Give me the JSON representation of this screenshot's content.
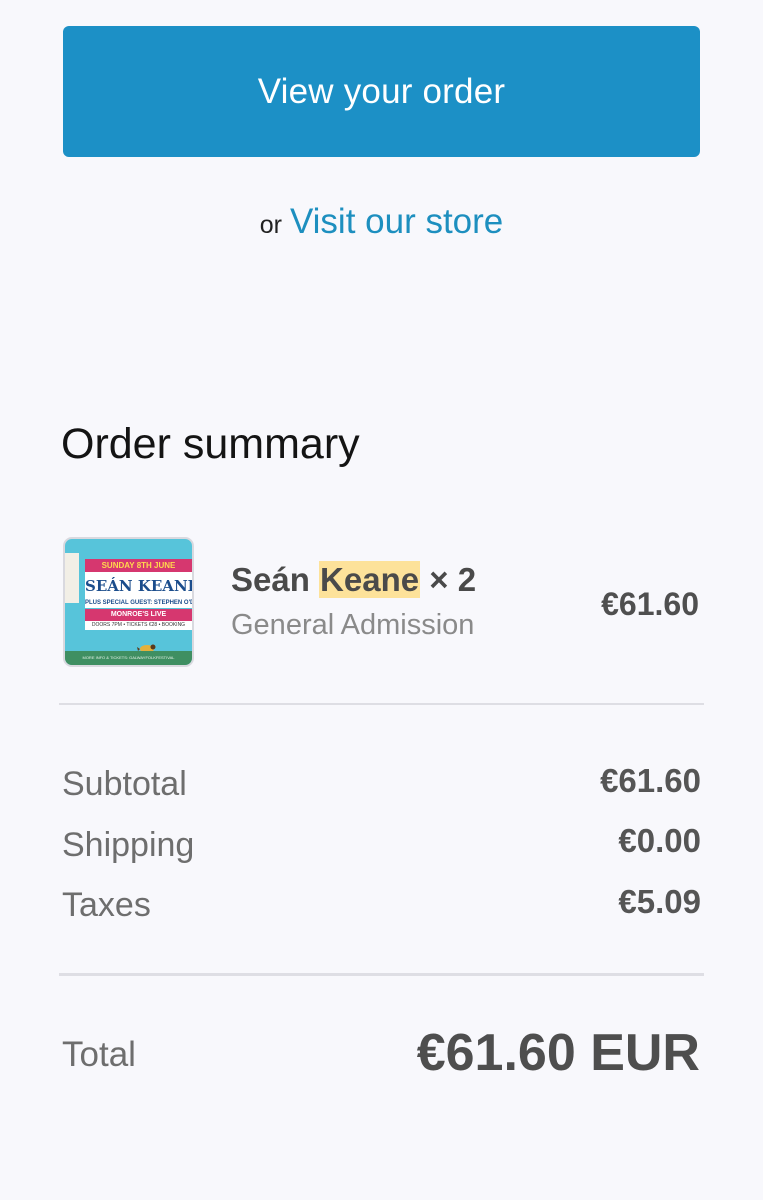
{
  "actions": {
    "view_order_label": "View your order",
    "or_text": "or",
    "visit_store_label": "Visit our store"
  },
  "summary": {
    "title": "Order summary",
    "item": {
      "name_first": "Seán",
      "name_highlight": "Keane",
      "quantity_text": "× 2",
      "variant": "General Admission",
      "price": "€61.60",
      "thumbnail": {
        "date_line": "SUNDAY 8TH JUNE",
        "headliner": "SEÁN KEANE",
        "guest_line": "PLUS SPECIAL GUEST: STEPHEN O'DOW",
        "venue_line": "MONROE'S LIVE",
        "doors_line": "DOORS 7PM • TICKETS €28 • BOOKING",
        "footer_line": "MORE INFO & TICKETS: GALWAYFOLKFESTIVAL"
      }
    },
    "rows": [
      {
        "label": "Subtotal",
        "value": "€61.60"
      },
      {
        "label": "Shipping",
        "value": "€0.00"
      },
      {
        "label": "Taxes",
        "value": "€5.09"
      }
    ],
    "total": {
      "label": "Total",
      "value": "€61.60 EUR"
    }
  },
  "colors": {
    "accent": "#1c90c6",
    "link": "#1d8fbf",
    "highlight": "#fde29a",
    "background": "#f8f8fc"
  }
}
